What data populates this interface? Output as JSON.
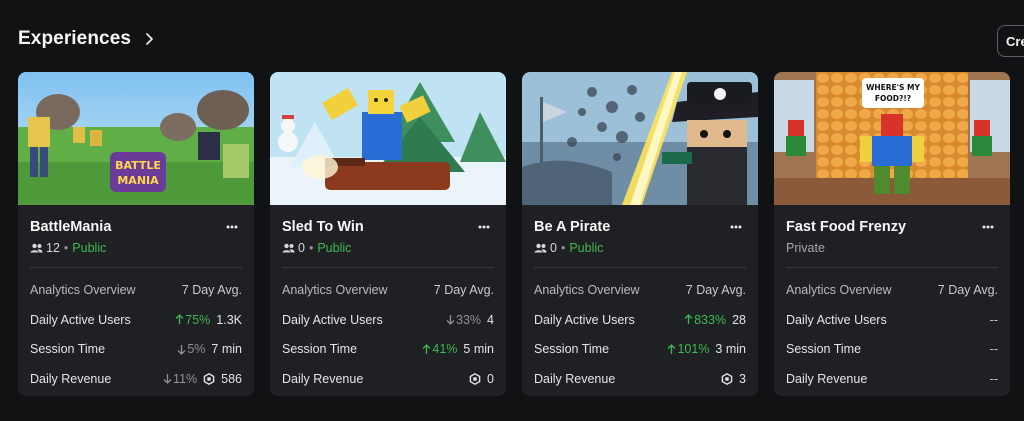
{
  "header": {
    "title": "Experiences",
    "create_label": "Create"
  },
  "colors": {
    "background": "#111214",
    "card": "#1f2024",
    "up": "#3fb950",
    "down": "#8e9096",
    "accent_public": "#3fb950"
  },
  "cards": [
    {
      "title": "BattleMania",
      "players": "12",
      "visibility": "Public",
      "thumbnail_logo": "BATTLE MANIA",
      "analytics_overview": "Analytics Overview",
      "avg_label": "7 Day Avg.",
      "stats": [
        {
          "label": "Daily Active Users",
          "change": "75%",
          "direction": "up",
          "value": "1.3K"
        },
        {
          "label": "Session Time",
          "change": "5%",
          "direction": "down",
          "value": "7 min"
        },
        {
          "label": "Daily Revenue",
          "change": "11%",
          "direction": "down",
          "value": "586",
          "robux": true
        }
      ]
    },
    {
      "title": "Sled To Win",
      "players": "0",
      "visibility": "Public",
      "analytics_overview": "Analytics Overview",
      "avg_label": "7 Day Avg.",
      "stats": [
        {
          "label": "Daily Active Users",
          "change": "33%",
          "direction": "down",
          "value": "4"
        },
        {
          "label": "Session Time",
          "change": "41%",
          "direction": "up",
          "value": "5 min"
        },
        {
          "label": "Daily Revenue",
          "change": "",
          "direction": "",
          "value": "0",
          "robux": true
        }
      ]
    },
    {
      "title": "Be A Pirate",
      "players": "0",
      "visibility": "Public",
      "analytics_overview": "Analytics Overview",
      "avg_label": "7 Day Avg.",
      "stats": [
        {
          "label": "Daily Active Users",
          "change": "833%",
          "direction": "up",
          "value": "28"
        },
        {
          "label": "Session Time",
          "change": "101%",
          "direction": "up",
          "value": "3 min"
        },
        {
          "label": "Daily Revenue",
          "change": "",
          "direction": "",
          "value": "3",
          "robux": true
        }
      ]
    },
    {
      "title": "Fast Food Frenzy",
      "players": "",
      "visibility": "Private",
      "thumbnail_caption": "WHERE'S MY FOOD?!?",
      "analytics_overview": "Analytics Overview",
      "avg_label": "7 Day Avg.",
      "stats": [
        {
          "label": "Daily Active Users",
          "change": "",
          "direction": "",
          "value": "--"
        },
        {
          "label": "Session Time",
          "change": "",
          "direction": "",
          "value": "--"
        },
        {
          "label": "Daily Revenue",
          "change": "",
          "direction": "",
          "value": "--"
        }
      ]
    }
  ]
}
